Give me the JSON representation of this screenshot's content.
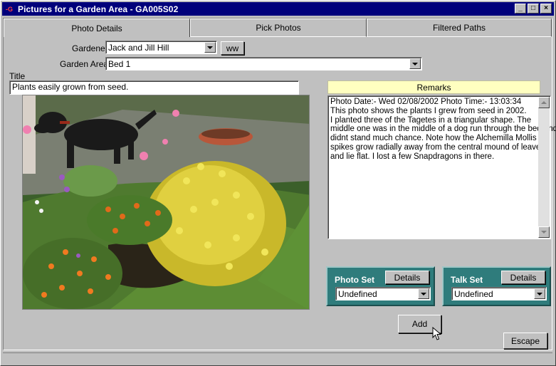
{
  "window": {
    "app_icon": "-G",
    "title": "Pictures for a Garden Area - GA005S02",
    "min_glyph": "_",
    "max_glyph": "□",
    "close_glyph": "×"
  },
  "tabs": [
    {
      "label": "Photo Details",
      "active": true
    },
    {
      "label": "Pick Photos",
      "active": false
    },
    {
      "label": "Filtered Paths",
      "active": false
    }
  ],
  "form": {
    "gardener_label": "Gardener",
    "gardener_value": "Jack and Jill Hill",
    "ww_button": "ww",
    "garden_area_label": "Garden Area",
    "garden_area_value": "Bed 1",
    "title_label": "Title",
    "title_value": "Plants easily grown from seed."
  },
  "remarks": {
    "header": "Remarks",
    "lines": [
      "Photo Date:- Wed 02/08/2002  Photo Time:- 13:03:34",
      "This photo shows the plants I grew from seed in 2002.",
      "I planted three of the Tagetes in a triangular shape. The",
      "middle one was in the middle of a dog run through the bed and",
      "didnt stand much chance. Note how the Alchemilla Mollis",
      "spikes grow radially away from the central mound of leaves",
      "and lie flat. I lost a few Snapdragons in there."
    ]
  },
  "photo_set": {
    "title": "Photo Set",
    "details_button": "Details",
    "value": "Undefined"
  },
  "talk_set": {
    "title": "Talk Set",
    "details_button": "Details",
    "value": "Undefined"
  },
  "buttons": {
    "add": "Add",
    "escape": "Escape"
  },
  "colors": {
    "titlebar": "#00007b",
    "panel": "#2f7c7c",
    "remarks_header": "#ffffc0"
  }
}
